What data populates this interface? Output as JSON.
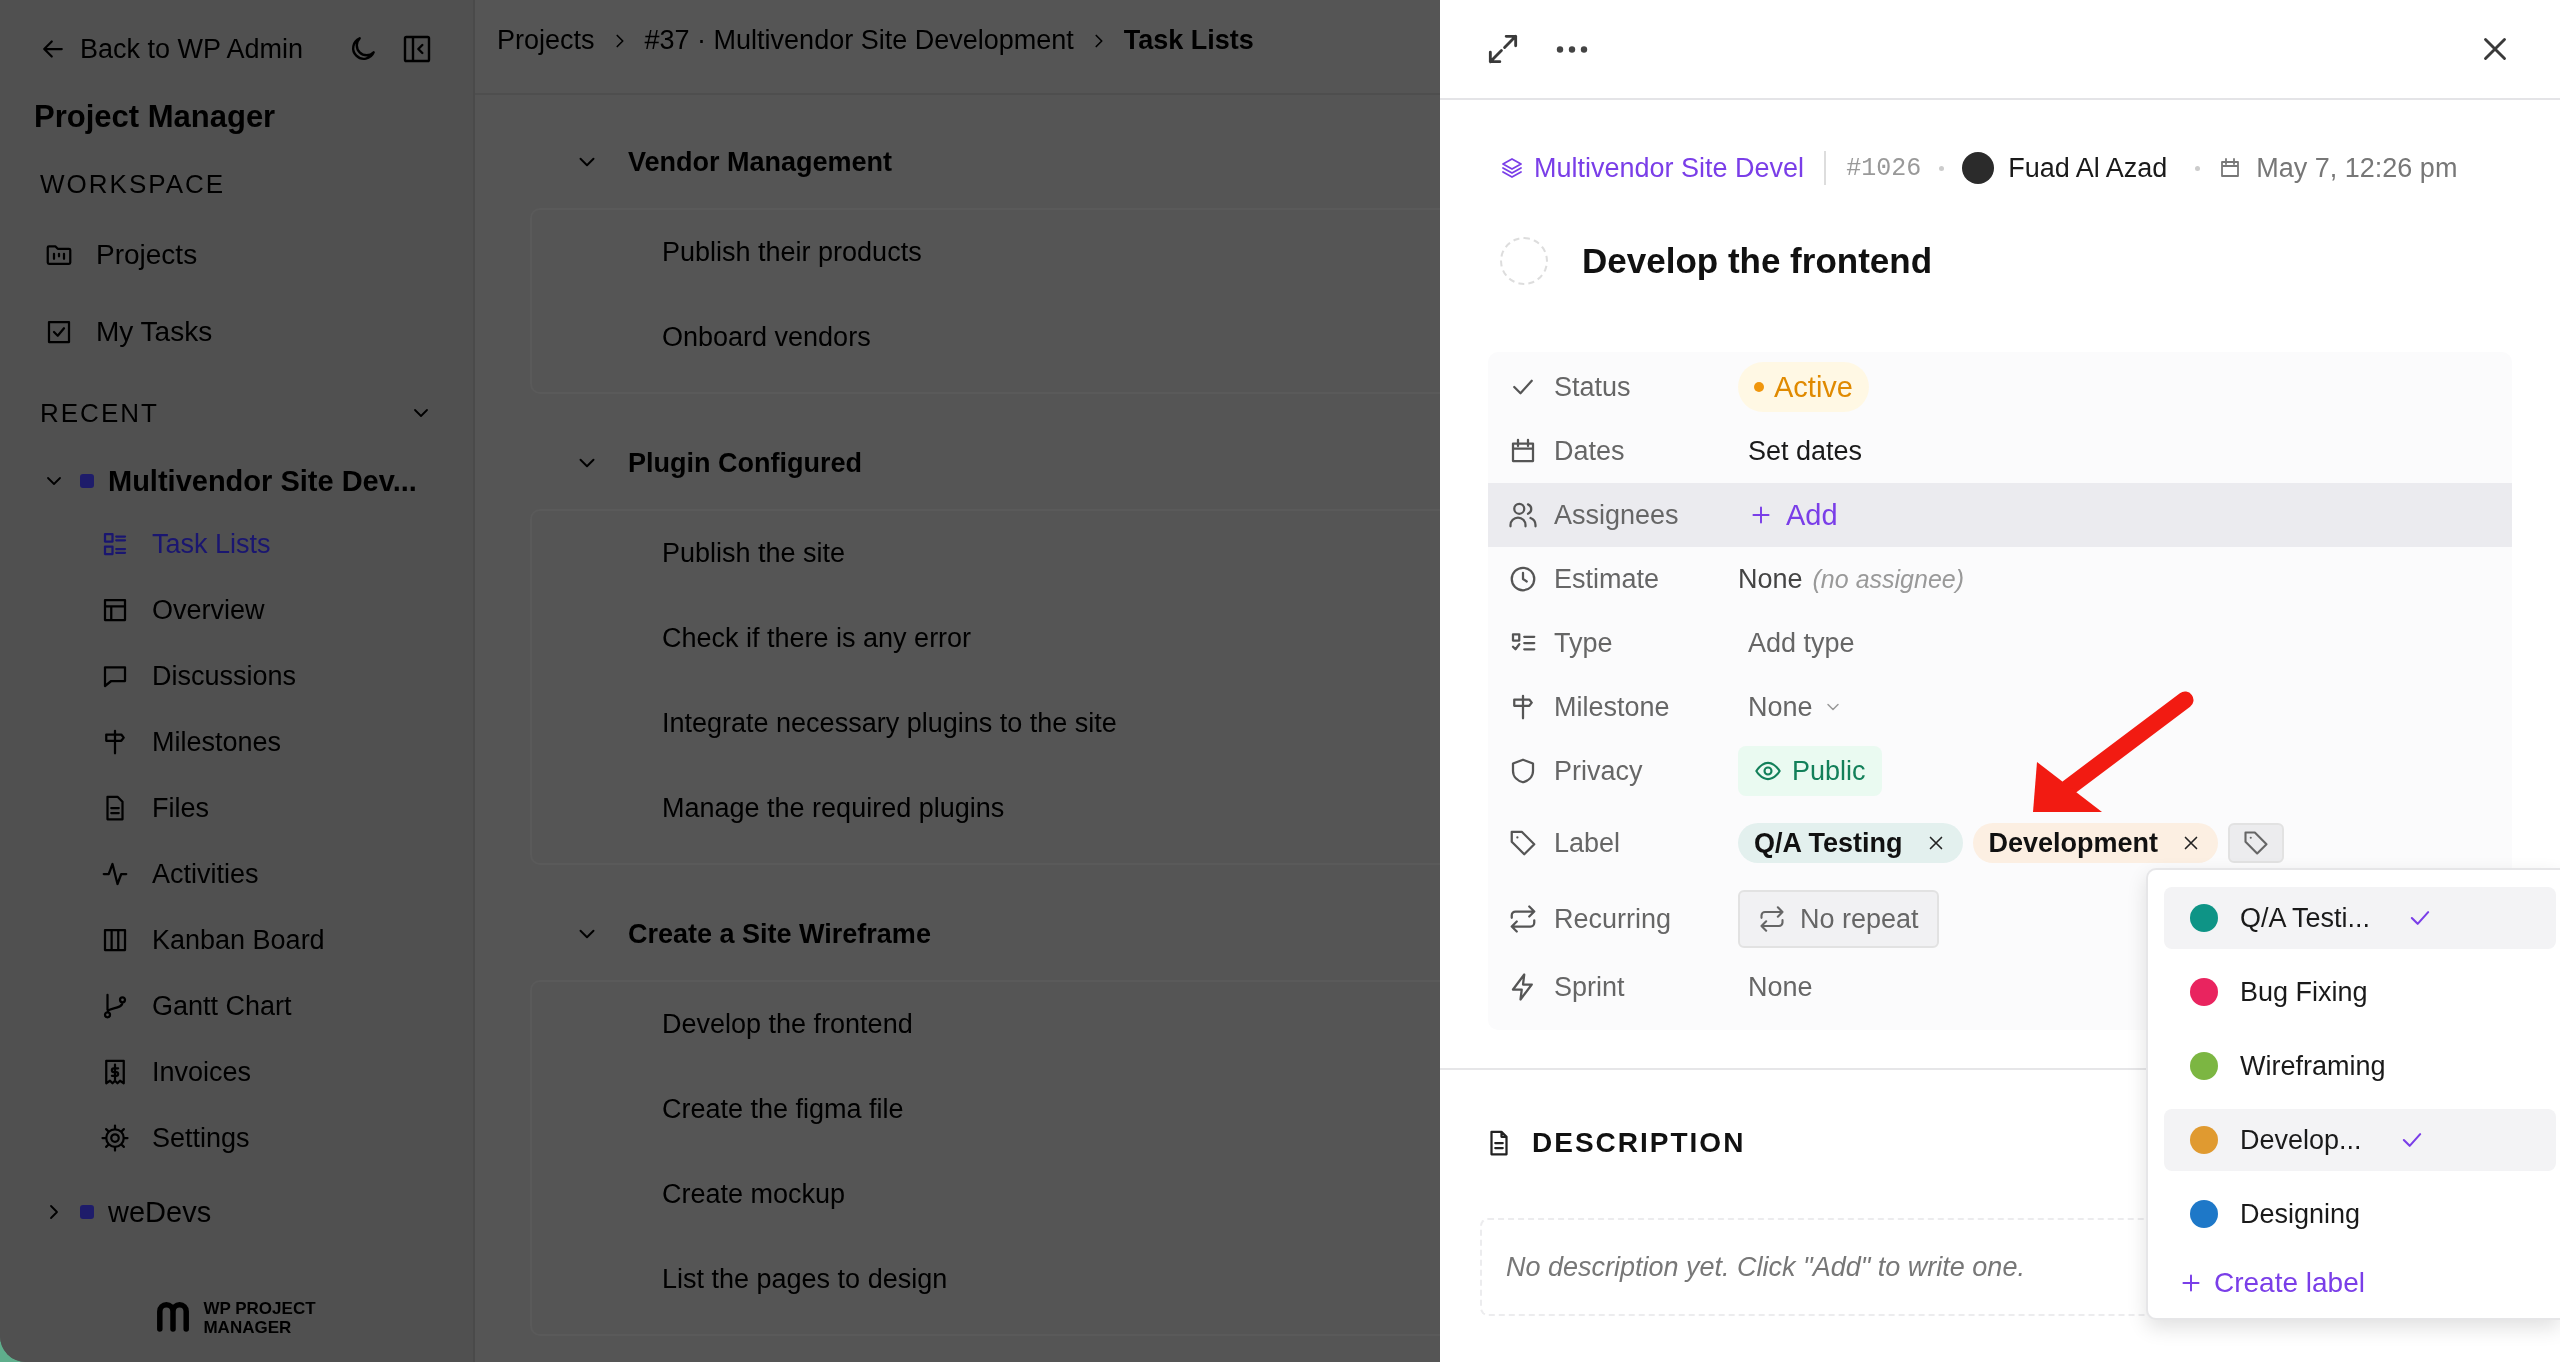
{
  "sidebar": {
    "back_link": "Back to WP Admin",
    "app_title": "Project Manager",
    "workspace_heading": "WORKSPACE",
    "workspace_items": [
      {
        "label": "Projects"
      },
      {
        "label": "My Tasks"
      }
    ],
    "recent_heading": "RECENT",
    "recent_expanded": true,
    "projects": [
      {
        "name": "Multivendor Site Dev...",
        "expanded": true,
        "children": [
          {
            "label": "Task Lists",
            "selected": true
          },
          {
            "label": "Overview",
            "selected": false
          },
          {
            "label": "Discussions",
            "selected": false
          },
          {
            "label": "Milestones",
            "selected": false
          },
          {
            "label": "Files",
            "selected": false
          },
          {
            "label": "Activities",
            "selected": false
          },
          {
            "label": "Kanban Board",
            "selected": false
          },
          {
            "label": "Gantt Chart",
            "selected": false
          },
          {
            "label": "Invoices",
            "selected": false
          },
          {
            "label": "Settings",
            "selected": false
          }
        ]
      },
      {
        "name": "weDevs",
        "expanded": false
      }
    ],
    "logo_text": [
      "WP PROJECT",
      "MANAGER"
    ]
  },
  "main": {
    "breadcrumb": [
      "Projects",
      "#37 · Multivendor Site Development",
      "Task Lists"
    ],
    "task_lists": [
      {
        "title": "Vendor Management",
        "expanded": true,
        "tasks": [
          "Publish their products",
          "Onboard vendors"
        ]
      },
      {
        "title": "Plugin Configured",
        "expanded": true,
        "tasks": [
          "Publish the site",
          "Check if there is any error",
          "Integrate necessary plugins to the site",
          "Manage the required plugins"
        ]
      },
      {
        "title": "Create a Site Wireframe",
        "expanded": true,
        "tasks": [
          "Develop the frontend",
          "Create the figma file",
          "Create mockup",
          "List the pages to design"
        ]
      }
    ]
  },
  "task_panel": {
    "project": "Multivendor Site Devel",
    "task_id": "#1026",
    "assignee": "Fuad Al Azad",
    "created": "May 7, 12:26 pm",
    "title": "Develop the frontend",
    "completed": false,
    "properties": [
      {
        "kind": "status",
        "label": "Status",
        "value": "Active",
        "highlighted": false
      },
      {
        "kind": "text",
        "label": "Dates",
        "value": "Set dates",
        "highlighted": false
      },
      {
        "kind": "add",
        "label": "Assignees",
        "value": "Add",
        "highlighted": true
      },
      {
        "kind": "estimate",
        "label": "Estimate",
        "value": "None",
        "note": "(no assignee)",
        "highlighted": false
      },
      {
        "kind": "muted",
        "label": "Type",
        "value": "Add type",
        "highlighted": false
      },
      {
        "kind": "select",
        "label": "Milestone",
        "value": "None",
        "highlighted": false
      },
      {
        "kind": "privacy",
        "label": "Privacy",
        "value": "Public",
        "highlighted": false
      },
      {
        "kind": "labels",
        "label": "Label",
        "highlighted": false,
        "chips": [
          {
            "name": "Q/A Testing",
            "color": "#e3f0ee"
          },
          {
            "name": "Development",
            "color": "#fcefe2"
          }
        ]
      },
      {
        "kind": "button",
        "label": "Recurring",
        "value": "No repeat",
        "highlighted": false
      },
      {
        "kind": "muted",
        "label": "Sprint",
        "value": "None",
        "highlighted": false
      }
    ],
    "description_heading": "DESCRIPTION",
    "description": {
      "placeholder": "No description yet. Click \"Add\" to write one."
    },
    "label_menu": {
      "items": [
        {
          "name": "Q/A Testi...",
          "color": "#0e9486",
          "checked": true
        },
        {
          "name": "Bug Fixing",
          "color": "#e9245f",
          "checked": false
        },
        {
          "name": "Wireframing",
          "color": "#7cb642",
          "checked": false
        },
        {
          "name": "Develop...",
          "color": "#e09a30",
          "checked": true
        },
        {
          "name": "Designing",
          "color": "#1e78c8",
          "checked": false
        }
      ],
      "create": "Create label"
    }
  }
}
